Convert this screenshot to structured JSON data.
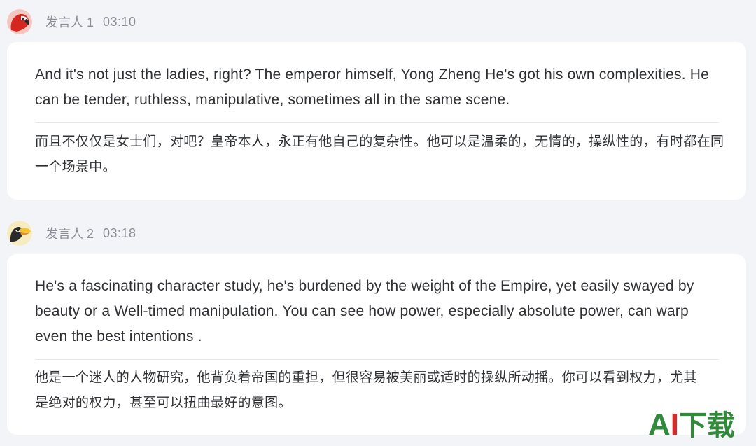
{
  "transcript": [
    {
      "speaker": "发言人 1",
      "time": "03:10",
      "avatar_icon": "red-parrot-avatar-icon",
      "original": "And it's not just the ladies, right? The emperor himself, Yong Zheng He's got his own complexities. He can be tender, ruthless, manipulative, sometimes all in the same scene.",
      "translation": "而且不仅仅是女士们，对吧？皇帝本人，永正有他自己的复杂性。他可以是温柔的，无情的，操纵性的，有时都在同一个场景中。"
    },
    {
      "speaker": "发言人 2",
      "time": "03:18",
      "avatar_icon": "toucan-avatar-icon",
      "original": "He's a fascinating character study, he's burdened by the weight of the Empire, yet easily swayed by beauty or a Well-timed manipulation. You can see how power, especially absolute power, can warp even the best intentions .",
      "translation": "他是一个迷人的人物研究，他背负着帝国的重担，但很容易被美丽或适时的操纵所动摇。你可以看到权力，尤其是绝对的权力，甚至可以扭曲最好的意图。"
    }
  ],
  "watermark": {
    "a": "A",
    "i": "I",
    "zh": "下载"
  },
  "colors": {
    "background": "#f3f4f7",
    "card": "#ffffff",
    "meta_text": "#8b8f99",
    "body_text": "#2f3033",
    "watermark_green": "#2f8a3a",
    "watermark_red": "#d32a2a"
  }
}
